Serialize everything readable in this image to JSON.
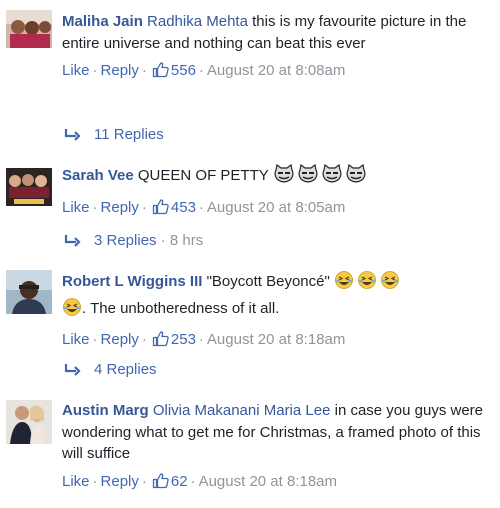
{
  "comments": [
    {
      "author": "Maliha Jain",
      "mention": "Radhika Mehta",
      "text": " this is my favourite picture in the entire universe and nothing can beat this ever",
      "like": "Like",
      "reply": "Reply",
      "likes": "556",
      "timestamp": "August 20 at 8:08am",
      "replies": "11 Replies"
    },
    {
      "author": "Sarah Vee",
      "text": " QUEEN OF PETTY ",
      "emoji_count": 4,
      "emoji": "cat-face-icon",
      "like": "Like",
      "reply": "Reply",
      "likes": "453",
      "timestamp": "August 20 at 8:05am",
      "replies": "3 Replies",
      "replies_age": "8 hrs"
    },
    {
      "author": "Robert L Wiggins III",
      "text": " \"Boycott Beyoncé\" ",
      "text2": ". The unbotheredness of it all.",
      "emoji": "laughing-face-icon",
      "like": "Like",
      "reply": "Reply",
      "likes": "253",
      "timestamp": "August 20 at 8:18am",
      "replies": "4 Replies"
    },
    {
      "author": "Austin Marg",
      "mentions": "Olivia Makanani Maria Lee",
      "text": " in case you guys were wondering what to get me for Christmas, a framed photo of this will suffice",
      "like": "Like",
      "reply": "Reply",
      "likes": "62",
      "timestamp": "August 20 at 8:18am"
    }
  ],
  "colors": {
    "author": "#365899",
    "link": "#4267b2",
    "meta": "#90949c",
    "text": "#1d2129"
  }
}
